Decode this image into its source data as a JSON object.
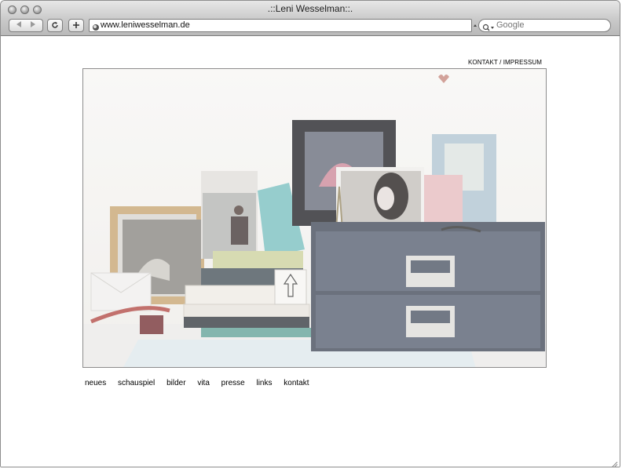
{
  "browser": {
    "title": ".::Leni Wesselman::.",
    "url": "www.leniwesselman.de",
    "search_placeholder": "Google"
  },
  "page": {
    "top_links": {
      "kontakt": "KONTAKT",
      "separator": " / ",
      "impressum": "IMPRESSUM"
    },
    "nav": [
      "neues",
      "schauspiel",
      "bilder",
      "vita",
      "presse",
      "links",
      "kontakt"
    ]
  },
  "icons": [
    "close-icon",
    "minimize-icon",
    "zoom-icon",
    "back-icon",
    "forward-icon",
    "reload-icon",
    "add-bookmark-icon",
    "site-favicon",
    "search-icon",
    "resize-grip-icon"
  ]
}
